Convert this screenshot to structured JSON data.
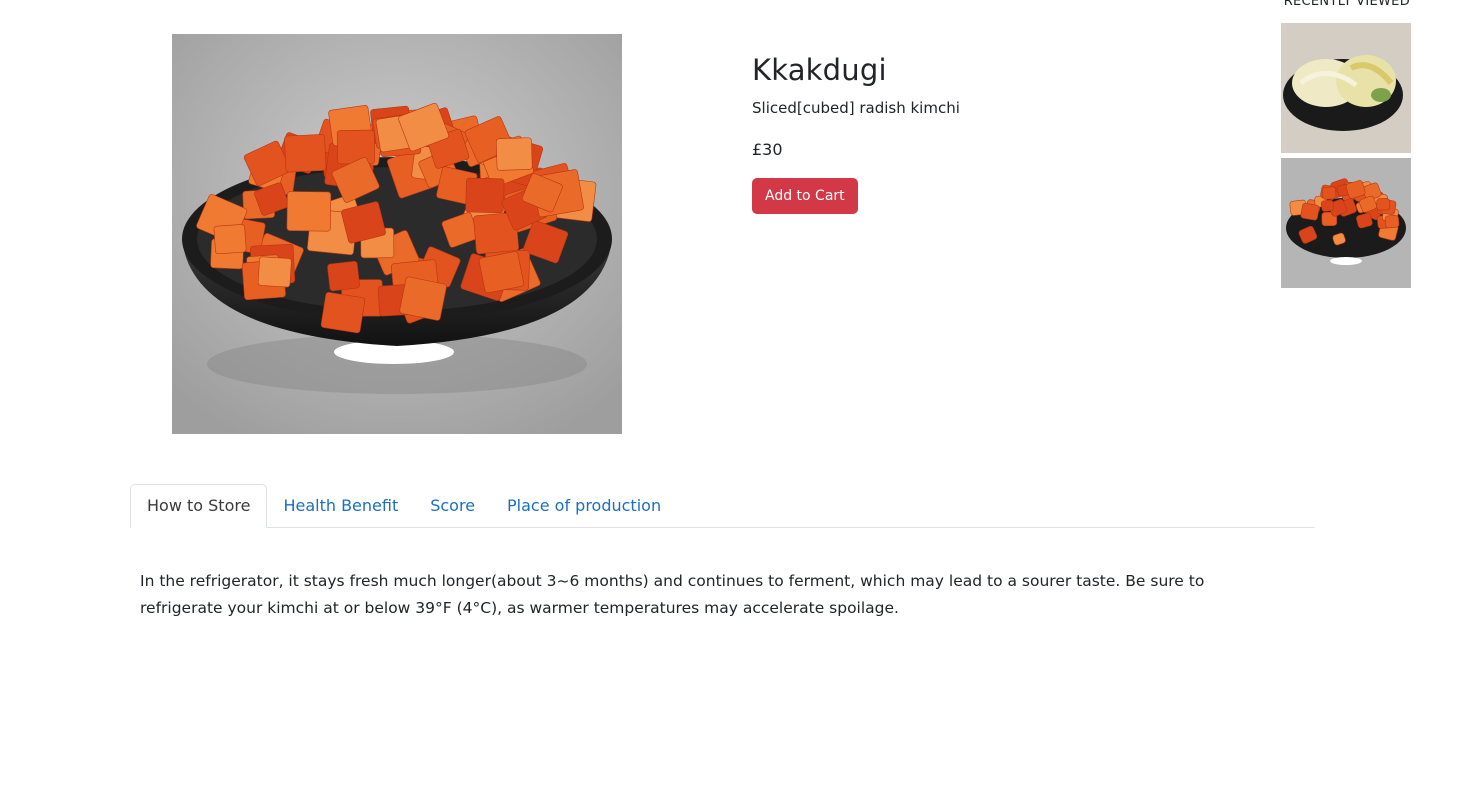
{
  "product": {
    "title": "Kkakdugi",
    "description": "Sliced[cubed] radish kimchi",
    "price": "£30",
    "add_to_cart_label": "Add to Cart"
  },
  "recently_viewed": {
    "title": "RECENTLY VIEWED"
  },
  "tabs": [
    {
      "label": "How to Store"
    },
    {
      "label": "Health Benefit"
    },
    {
      "label": "Score"
    },
    {
      "label": "Place of production"
    }
  ],
  "active_tab": "How to Store",
  "tab_content": "In the refrigerator, it stays fresh much longer(about 3~6 months) and continues to ferment, which may lead to a sourer taste. Be sure to refrigerate your kimchi at or below 39°F (4°C), as warmer temperatures may accelerate spoilage.",
  "colors": {
    "accent_button": "#d23845",
    "tab_link": "#1a6fc4"
  }
}
